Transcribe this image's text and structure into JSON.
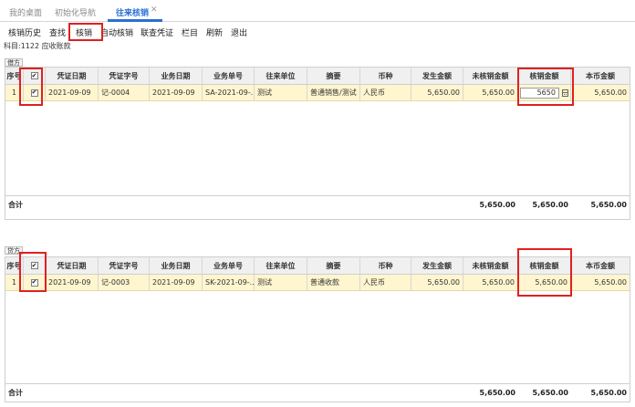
{
  "tabs": [
    {
      "label": "我的桌面",
      "active": false
    },
    {
      "label": "初始化导航",
      "active": false
    },
    {
      "label": "往来核销",
      "active": true
    }
  ],
  "tab_close_glyph": "✕",
  "toolbar": {
    "items": [
      "核销历史",
      "查找",
      "核销",
      "自动核销",
      "联查凭证",
      "栏目",
      "刷新",
      "退出"
    ]
  },
  "subject_line": "科目:1122 应收账款",
  "columns": [
    "序号",
    "",
    "凭证日期",
    "凭证字号",
    "业务日期",
    "业务单号",
    "往来单位",
    "摘要",
    "币种",
    "发生金额",
    "未核销金额",
    "核销金额",
    "本币金额"
  ],
  "debit": {
    "label": "借方",
    "rows": [
      {
        "no": "1",
        "checked": true,
        "voucher_date": "2021-09-09",
        "voucher_no": "记-0004",
        "biz_date": "2021-09-09",
        "biz_no": "SA-2021-09-...",
        "partner": "测试",
        "summary": "普通销售/测试",
        "currency": "人民币",
        "amount": "5,650.00",
        "unsettled": "5,650.00",
        "settle": "5650",
        "base_amount": "5,650.00"
      }
    ],
    "total": {
      "label": "合计",
      "unsettled": "5,650.00",
      "settle": "5,650.00",
      "base_amount": "5,650.00"
    }
  },
  "credit": {
    "label": "贷方",
    "rows": [
      {
        "no": "1",
        "checked": true,
        "voucher_date": "2021-09-09",
        "voucher_no": "记-0003",
        "biz_date": "2021-09-09",
        "biz_no": "SK-2021-09-...",
        "partner": "测试",
        "summary": "普通收款",
        "currency": "人民币",
        "amount": "5,650.00",
        "unsettled": "5,650.00",
        "settle": "5,650.00",
        "base_amount": "5,650.00"
      }
    ],
    "total": {
      "label": "合计",
      "unsettled": "5,650.00",
      "settle": "5,650.00",
      "base_amount": "5,650.00"
    }
  },
  "check_glyph": "✔",
  "colors": {
    "accent": "#2a6fd6",
    "highlight_box": "#e02020",
    "row_bg": "#fff6cf"
  }
}
